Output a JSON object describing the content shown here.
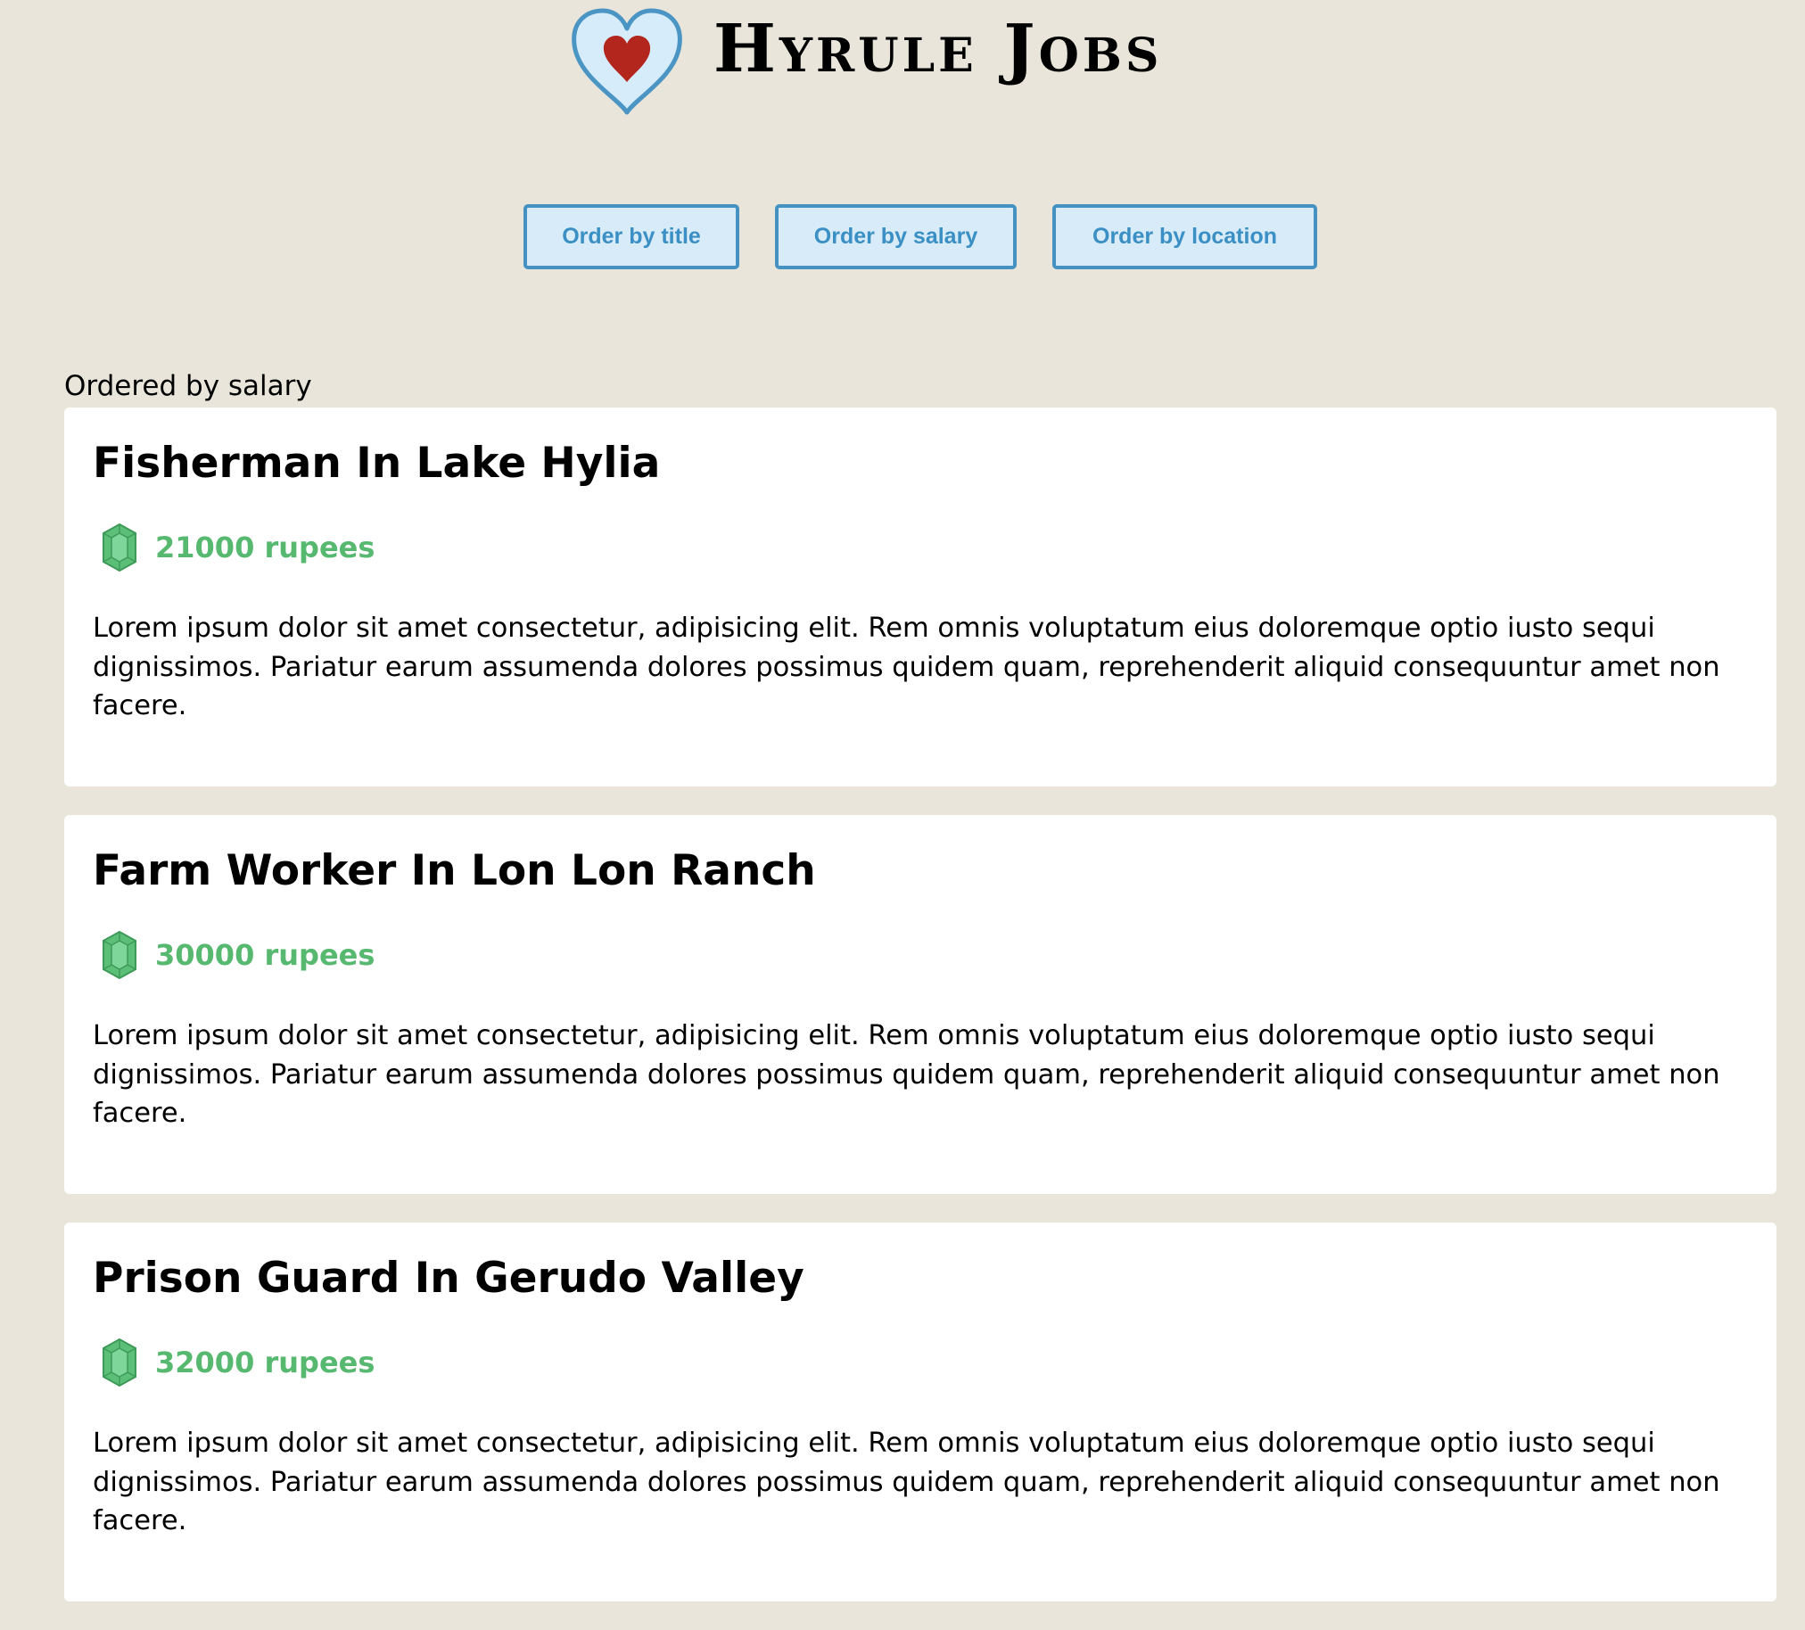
{
  "header": {
    "site_title": "Hyrule Jobs",
    "logo_icon": "heart-container-icon"
  },
  "actions": {
    "order_by_title": "Order by title",
    "order_by_salary": "Order by salary",
    "order_by_location": "Order by location"
  },
  "order_status": "Ordered by salary",
  "jobs": [
    {
      "title": "Fisherman In Lake Hylia",
      "salary": "21000 rupees",
      "description": "Lorem ipsum dolor sit amet consectetur, adipisicing elit. Rem omnis voluptatum eius doloremque optio iusto sequi dignissimos. Pariatur earum assumenda dolores possimus quidem quam, reprehenderit aliquid consequuntur amet non facere."
    },
    {
      "title": "Farm Worker In Lon Lon Ranch",
      "salary": "30000 rupees",
      "description": "Lorem ipsum dolor sit amet consectetur, adipisicing elit. Rem omnis voluptatum eius doloremque optio iusto sequi dignissimos. Pariatur earum assumenda dolores possimus quidem quam, reprehenderit aliquid consequuntur amet non facere."
    },
    {
      "title": "Prison Guard In Gerudo Valley",
      "salary": "32000 rupees",
      "description": "Lorem ipsum dolor sit amet consectetur, adipisicing elit. Rem omnis voluptatum eius doloremque optio iusto sequi dignissimos. Pariatur earum assumenda dolores possimus quidem quam, reprehenderit aliquid consequuntur amet non facere."
    }
  ],
  "icons": {
    "salary_icon": "rupee-gem-icon"
  },
  "colors": {
    "background": "#e9e5da",
    "button_border": "#4592c2",
    "button_fill": "#d8ebf8",
    "button_text": "#3a8fc4",
    "salary_green": "#57b870",
    "heart_red": "#b3261e"
  }
}
